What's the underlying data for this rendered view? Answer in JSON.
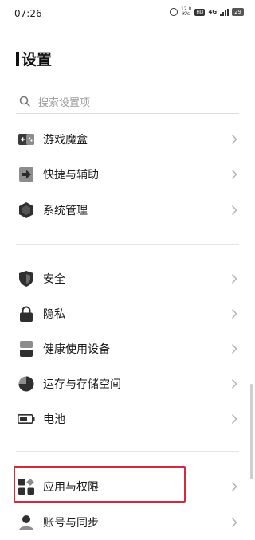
{
  "status": {
    "time": "07:26",
    "speed": "12.0",
    "speed_unit": "K/s",
    "hd": "HD",
    "signal": "4G",
    "battery": "29"
  },
  "header": {
    "title": "设置"
  },
  "search": {
    "placeholder": "搜索设置项"
  },
  "sections": {
    "group1": [
      {
        "label": "游戏魔盒",
        "icon": "game-box-icon"
      },
      {
        "label": "快捷与辅助",
        "icon": "shortcut-icon"
      },
      {
        "label": "系统管理",
        "icon": "system-hexagon-icon"
      }
    ],
    "group2": [
      {
        "label": "安全",
        "icon": "shield-icon"
      },
      {
        "label": "隐私",
        "icon": "lock-icon"
      },
      {
        "label": "健康使用设备",
        "icon": "hourglass-icon"
      },
      {
        "label": "运存与存储空间",
        "icon": "pie-storage-icon"
      },
      {
        "label": "电池",
        "icon": "battery-icon"
      }
    ],
    "group3": [
      {
        "label": "应用与权限",
        "icon": "apps-grid-icon"
      },
      {
        "label": "账号与同步",
        "icon": "account-icon"
      }
    ]
  }
}
